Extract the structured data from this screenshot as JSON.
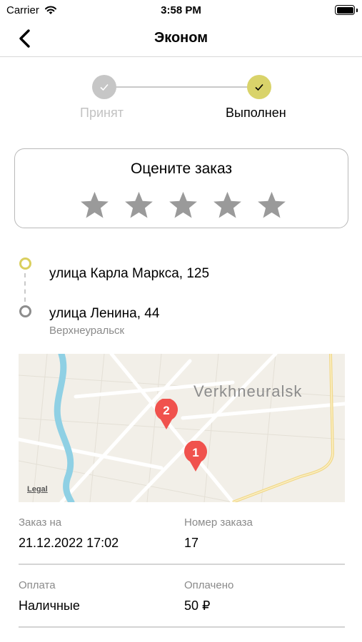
{
  "status_bar": {
    "carrier": "Carrier",
    "time": "3:58 PM"
  },
  "nav": {
    "title": "Эконом",
    "back_icon": "chevron-left-icon"
  },
  "progress": {
    "steps": [
      {
        "label": "Принят",
        "state": "done-inactive",
        "icon": "check-icon",
        "color": "#c6c6c6"
      },
      {
        "label": "Выполнен",
        "state": "current",
        "icon": "check-icon",
        "color": "#d9d36a"
      }
    ]
  },
  "rating": {
    "title": "Оцените заказ",
    "max_stars": 5,
    "selected": 0,
    "star_color": "#9a9a9a"
  },
  "route": {
    "from": {
      "address": "улица Карла Маркса, 125",
      "dot_color": "#dacf5e"
    },
    "to": {
      "address": "улица Ленина, 44",
      "city": "Верхнеуральск",
      "dot_color": "#8d8d8d"
    }
  },
  "map": {
    "city_label": "Verkhneuralsk",
    "legal": "Legal",
    "pins": [
      {
        "label": "1",
        "color": "#f0524d"
      },
      {
        "label": "2",
        "color": "#f0524d"
      }
    ]
  },
  "details": {
    "order_date_label": "Заказ на",
    "order_date_value": "21.12.2022 17:02",
    "order_number_label": "Номер заказа",
    "order_number_value": "17",
    "payment_label": "Оплата",
    "payment_value": "Наличные",
    "paid_label": "Оплачено",
    "paid_value": "50 ₽"
  }
}
